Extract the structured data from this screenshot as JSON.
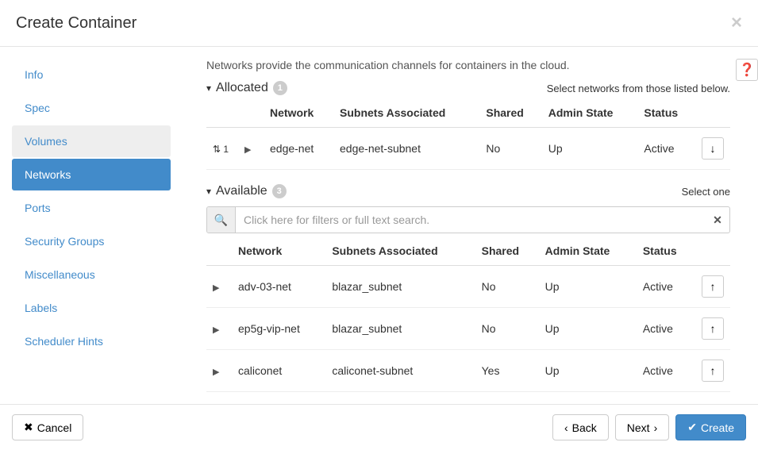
{
  "header": {
    "title": "Create Container"
  },
  "sidebar": {
    "items": [
      {
        "label": "Info",
        "state": ""
      },
      {
        "label": "Spec",
        "state": ""
      },
      {
        "label": "Volumes",
        "state": "highlighted"
      },
      {
        "label": "Networks",
        "state": "active"
      },
      {
        "label": "Ports",
        "state": ""
      },
      {
        "label": "Security Groups",
        "state": ""
      },
      {
        "label": "Miscellaneous",
        "state": ""
      },
      {
        "label": "Labels",
        "state": ""
      },
      {
        "label": "Scheduler Hints",
        "state": ""
      }
    ]
  },
  "main": {
    "intro": "Networks provide the communication channels for containers in the cloud.",
    "allocated": {
      "title": "Allocated",
      "count": "1",
      "hint": "Select networks from those listed below.",
      "columns": {
        "c1": "",
        "c2": "",
        "c3": "Network",
        "c4": "Subnets Associated",
        "c5": "Shared",
        "c6": "Admin State",
        "c7": "Status",
        "c8": ""
      },
      "rows": [
        {
          "order": "1",
          "network": "edge-net",
          "subnets": "edge-net-subnet",
          "shared": "No",
          "admin": "Up",
          "status": "Active"
        }
      ]
    },
    "available": {
      "title": "Available",
      "count": "3",
      "hint": "Select one",
      "search_placeholder": "Click here for filters or full text search.",
      "columns": {
        "c1": "",
        "c2": "Network",
        "c3": "Subnets Associated",
        "c4": "Shared",
        "c5": "Admin State",
        "c6": "Status",
        "c7": ""
      },
      "rows": [
        {
          "network": "adv-03-net",
          "subnets": "blazar_subnet",
          "shared": "No",
          "admin": "Up",
          "status": "Active"
        },
        {
          "network": "ep5g-vip-net",
          "subnets": "blazar_subnet",
          "shared": "No",
          "admin": "Up",
          "status": "Active"
        },
        {
          "network": "caliconet",
          "subnets": "caliconet-subnet",
          "shared": "Yes",
          "admin": "Up",
          "status": "Active"
        }
      ]
    }
  },
  "footer": {
    "cancel": "Cancel",
    "back": "Back",
    "next": "Next",
    "create": "Create"
  }
}
